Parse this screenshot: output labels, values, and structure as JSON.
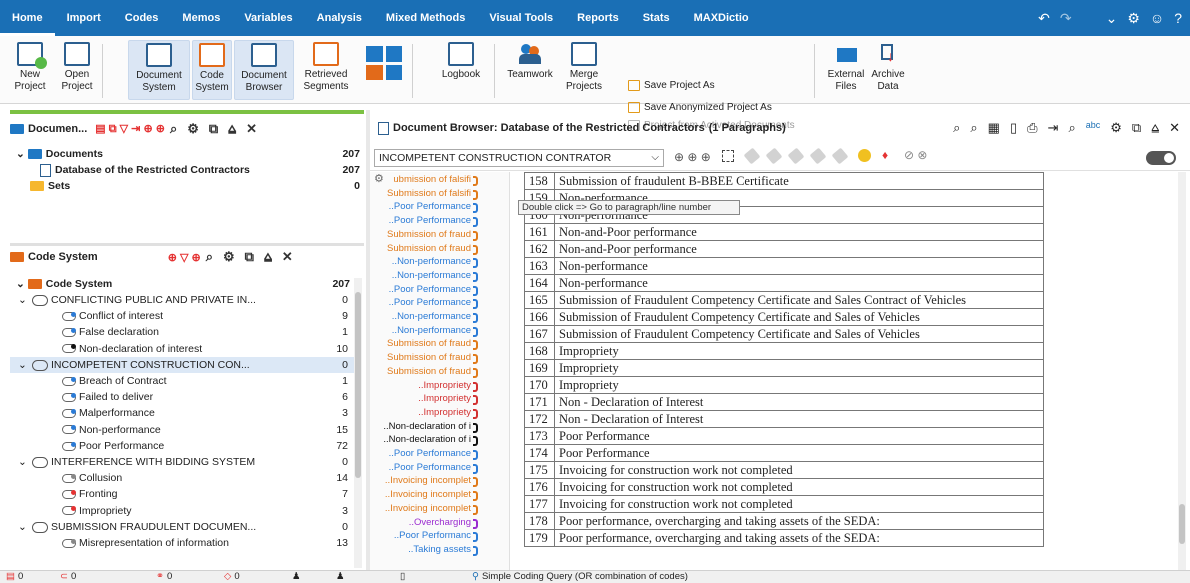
{
  "menubar": {
    "items": [
      "Home",
      "Import",
      "Codes",
      "Memos",
      "Variables",
      "Analysis",
      "Mixed Methods",
      "Visual Tools",
      "Reports",
      "Stats",
      "MAXDictio"
    ]
  },
  "ribbon": {
    "new_project": "New Project",
    "open_project": "Open Project",
    "document_system": "Document System",
    "code_system": "Code System",
    "document_browser": "Document Browser",
    "retrieved_segments": "Retrieved Segments",
    "logbook": "Logbook",
    "teamwork": "Teamwork",
    "merge_projects": "Merge Projects",
    "save_project_as": "Save Project As",
    "save_anonymized": "Save Anonymized Project As",
    "project_from_activated": "Project from Activated Documents",
    "external_files": "External Files",
    "archive_data": "Archive Data"
  },
  "doc_panel": {
    "title": "Documen...",
    "documents_label": "Documents",
    "documents_count": "207",
    "database_label": "Database of the Restricted Contractors",
    "database_count": "207",
    "sets_label": "Sets",
    "sets_count": "0"
  },
  "code_panel": {
    "title": "Code System",
    "root_label": "Code System",
    "root_count": "207",
    "rows": [
      {
        "label": "CONFLICTING PUBLIC AND PRIVATE IN...",
        "count": "0",
        "level": 1,
        "group": true
      },
      {
        "label": "Conflict of interest",
        "count": "9",
        "level": 2,
        "color": "blue"
      },
      {
        "label": "False declaration",
        "count": "1",
        "level": 2,
        "color": "blue"
      },
      {
        "label": "Non-declaration of interest",
        "count": "10",
        "level": 2,
        "color": "black"
      },
      {
        "label": "INCOMPETENT CONSTRUCTION CON...",
        "count": "0",
        "level": 1,
        "group": true,
        "selected": true
      },
      {
        "label": "Breach of Contract",
        "count": "1",
        "level": 2,
        "color": "blue"
      },
      {
        "label": "Failed to deliver",
        "count": "6",
        "level": 2,
        "color": "blue"
      },
      {
        "label": "Malperformance",
        "count": "3",
        "level": 2,
        "color": "blue"
      },
      {
        "label": "Non-performance",
        "count": "15",
        "level": 2,
        "color": "blue"
      },
      {
        "label": "Poor Performance",
        "count": "72",
        "level": 2,
        "color": "blue"
      },
      {
        "label": "INTERFERENCE WITH BIDDING SYSTEM",
        "count": "0",
        "level": 1,
        "group": true
      },
      {
        "label": "Collusion",
        "count": "14",
        "level": 2,
        "color": "gray"
      },
      {
        "label": "Fronting",
        "count": "7",
        "level": 2,
        "color": "red"
      },
      {
        "label": "Impropriety",
        "count": "3",
        "level": 2,
        "color": "red"
      },
      {
        "label": "SUBMISSION FRAUDULENT DOCUMEN...",
        "count": "0",
        "level": 1,
        "group": true
      },
      {
        "label": "Misrepresentation of information",
        "count": "13",
        "level": 2,
        "color": "gray"
      }
    ]
  },
  "browser": {
    "title": "Document Browser: Database of the Restricted Contractors",
    "paragraphs": "(1 Paragraphs)",
    "combo_value": "INCOMPETENT CONSTRUCTION CONTRATOR",
    "tooltip": "Double click => Go to paragraph/line number",
    "rows": [
      {
        "n": "158",
        "t": "Submission of fraudulent B-BBEE Certificate"
      },
      {
        "n": "159",
        "t": "Non-performance"
      },
      {
        "n": "160",
        "t": "Non-performance"
      },
      {
        "n": "161",
        "t": "Non-and-Poor performance"
      },
      {
        "n": "162",
        "t": "Non-and-Poor performance"
      },
      {
        "n": "163",
        "t": "Non-performance"
      },
      {
        "n": "164",
        "t": "Non-performance"
      },
      {
        "n": "165",
        "t": "Submission of Fraudulent Competency Certificate and Sales Contract of Vehicles"
      },
      {
        "n": "166",
        "t": "Submission of Fraudulent Competency Certificate and Sales of Vehicles"
      },
      {
        "n": "167",
        "t": "Submission of Fraudulent Competency Certificate and Sales of Vehicles"
      },
      {
        "n": "168",
        "t": "Impropriety"
      },
      {
        "n": "169",
        "t": "Impropriety"
      },
      {
        "n": "170",
        "t": "Impropriety"
      },
      {
        "n": "171",
        "t": "Non - Declaration of Interest"
      },
      {
        "n": "172",
        "t": "Non - Declaration of Interest"
      },
      {
        "n": "173",
        "t": "Poor Performance"
      },
      {
        "n": "174",
        "t": "Poor Performance"
      },
      {
        "n": "175",
        "t": "Invoicing for construction work not completed"
      },
      {
        "n": "176",
        "t": "Invoicing for construction work not completed"
      },
      {
        "n": "177",
        "t": "Invoicing for construction work not completed"
      },
      {
        "n": "178",
        "t": "Poor performance, overcharging and taking assets of the SEDA:"
      },
      {
        "n": "179",
        "t": "Poor performance, overcharging and taking assets of the SEDA:"
      }
    ],
    "margin_codes": [
      {
        "t": "ubmission of falsifi",
        "c": "orange"
      },
      {
        "t": "Submission of falsifi",
        "c": "orange"
      },
      {
        "t": "..Poor Performance",
        "c": "blue"
      },
      {
        "t": "..Poor Performance",
        "c": "blue"
      },
      {
        "t": "Submission of fraud",
        "c": "orange"
      },
      {
        "t": "Submission of fraud",
        "c": "orange"
      },
      {
        "t": "..Non-performance",
        "c": "blue"
      },
      {
        "t": "..Non-performance",
        "c": "blue"
      },
      {
        "t": "..Poor Performance",
        "c": "blue"
      },
      {
        "t": "..Poor Performance",
        "c": "blue"
      },
      {
        "t": "..Non-performance",
        "c": "blue"
      },
      {
        "t": "..Non-performance",
        "c": "blue"
      },
      {
        "t": "Submission of fraud",
        "c": "orange"
      },
      {
        "t": "Submission of fraud",
        "c": "orange"
      },
      {
        "t": "Submission of fraud",
        "c": "orange"
      },
      {
        "t": "..Impropriety",
        "c": "red"
      },
      {
        "t": "..Impropriety",
        "c": "red"
      },
      {
        "t": "..Impropriety",
        "c": "red"
      },
      {
        "t": "..Non-declaration of i",
        "c": "black"
      },
      {
        "t": "..Non-declaration of i",
        "c": "black"
      },
      {
        "t": "..Poor Performance",
        "c": "blue"
      },
      {
        "t": "..Poor Performance",
        "c": "blue"
      },
      {
        "t": "..Invoicing incomplet",
        "c": "orange"
      },
      {
        "t": "..Invoicing incomplet",
        "c": "orange"
      },
      {
        "t": "..Invoicing incomplet",
        "c": "orange"
      },
      {
        "t": "..Overcharging",
        "c": "purple"
      },
      {
        "t": "..Poor Performanc",
        "c": "blue"
      },
      {
        "t": "..Taking assets",
        "c": "blue"
      }
    ]
  },
  "status": {
    "docs": "0",
    "codes": "0",
    "memos": "0",
    "links": "0",
    "query": "Simple Coding Query (OR combination of codes)"
  },
  "colors": {
    "menubar": "#1a6fb5",
    "accent_green": "#7bc142"
  }
}
